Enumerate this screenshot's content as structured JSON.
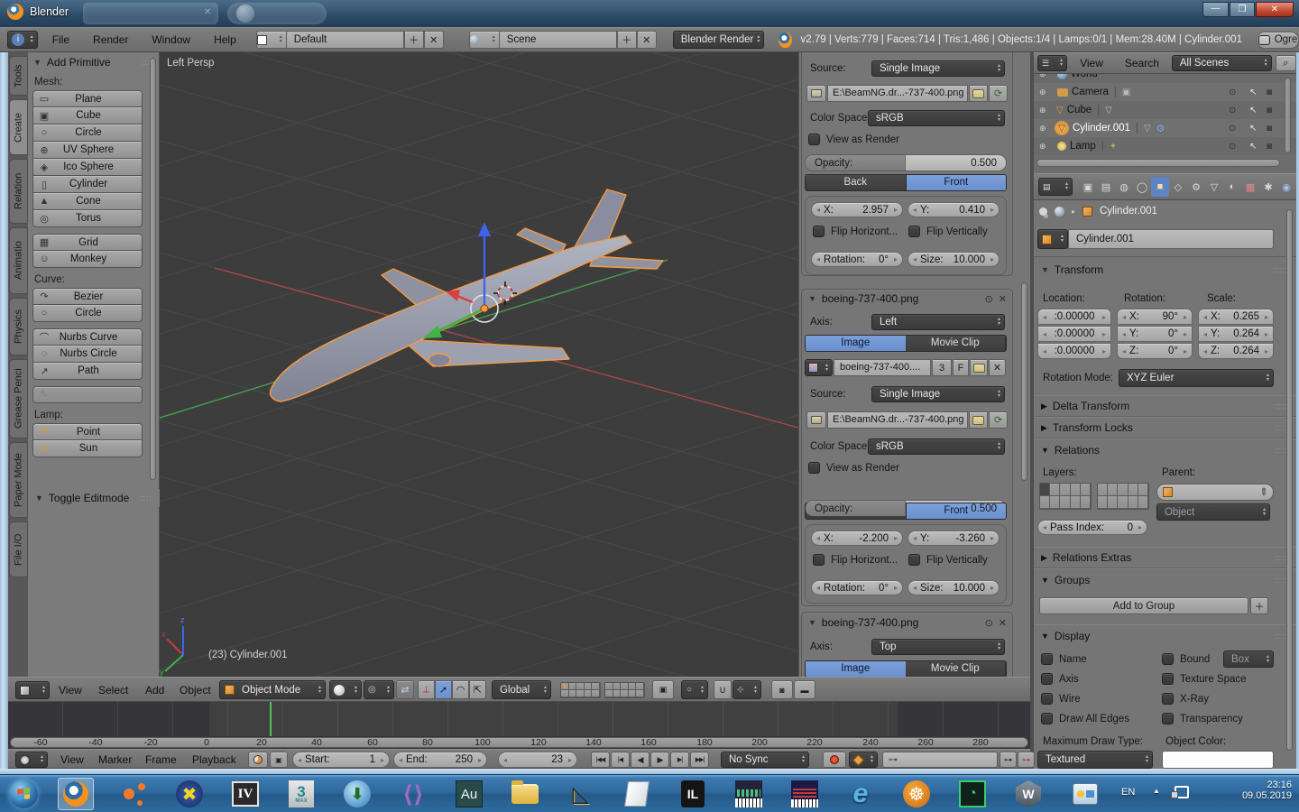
{
  "colors": {
    "accent_blue": "#6a90cf",
    "blender_orange": "#f5921e",
    "selection_outline_orange": "#f49b42",
    "current_frame_green": "#54c554",
    "viewport_bg": "#3d3d3d",
    "taskbar_blue": "#2f6a9e"
  },
  "window": {
    "title": "Blender"
  },
  "header": {
    "menus": [
      "File",
      "Render",
      "Window",
      "Help"
    ],
    "layout": "Default",
    "scene": "Scene",
    "engine": "Blender Render",
    "stats": "v2.79 | Verts:779 | Faces:714 | Tris:1,486 | Objects:1/4 | Lamps:0/1 | Mem:28.40M | Cylinder.001",
    "ogre": "Ogre"
  },
  "toolshelf": {
    "tabs": [
      "Tools",
      "Create",
      "Relation",
      "Animatio",
      "Physics",
      "Grease Penci",
      "Paper Mode",
      "File I/O"
    ],
    "panel_title": "Add Primitive",
    "mesh_label": "Mesh:",
    "mesh": [
      "Plane",
      "Cube",
      "Circle",
      "UV Sphere",
      "Ico Sphere",
      "Cylinder",
      "Cone",
      "Torus"
    ],
    "mesh2": [
      "Grid",
      "Monkey"
    ],
    "curve_label": "Curve:",
    "curve": [
      "Bezier",
      "Circle"
    ],
    "curve2": [
      "Nurbs Curve",
      "Nurbs Circle",
      "Path"
    ],
    "curve_disabled": "Draw Curve",
    "lamp_label": "Lamp:",
    "lamp": [
      "Point",
      "Sun"
    ],
    "editmode_panel": "Toggle Editmode"
  },
  "viewport": {
    "view_label": "Left Persp",
    "status": "(23) Cylinder.001",
    "axis": {
      "x": "x",
      "y": "y",
      "z": "z"
    },
    "header": {
      "menus": [
        "View",
        "Select",
        "Add",
        "Object"
      ],
      "mode": "Object Mode",
      "orientation": "Global"
    }
  },
  "bg_panels": {
    "labels": {
      "source": "Source:",
      "color_space": "Color Space:",
      "view_as_render": "View as Render",
      "opacity": "Opacity:",
      "back": "Back",
      "front": "Front",
      "x": "X:",
      "y": "Y:",
      "flip_h": "Flip Horizont...",
      "flip_v": "Flip Vertically",
      "rotation": "Rotation:",
      "size": "Size:",
      "axis": "Axis:",
      "image": "Image",
      "movie_clip": "Movie Clip"
    },
    "p1": {
      "source": "Single Image",
      "path": "E:\\BeamNG.dr...-737-400.png",
      "color_space": "sRGB",
      "opacity": "0.500",
      "x": "2.957",
      "y": "0.410",
      "rotation": "0°",
      "size": "10.000"
    },
    "p2": {
      "title": "boeing-737-400.png",
      "axis": "Left",
      "datablock": "boeing-737-400....",
      "users": "3",
      "fake": "F",
      "source": "Single Image",
      "path": "E:\\BeamNG.dr...-737-400.png",
      "color_space": "sRGB",
      "opacity": "0.500",
      "x": "-2.200",
      "y": "-3.260",
      "rotation": "0°",
      "size": "10.000"
    },
    "p3": {
      "title": "boeing-737-400.png",
      "axis": "Top"
    }
  },
  "outliner": {
    "menus": [
      "View",
      "Search"
    ],
    "filter": "All Scenes",
    "rows": [
      {
        "name": "World"
      },
      {
        "name": "Camera"
      },
      {
        "name": "Cube"
      },
      {
        "name": "Cylinder.001"
      },
      {
        "name": "Lamp"
      }
    ]
  },
  "properties": {
    "breadcrumb": "Cylinder.001",
    "name": "Cylinder.001",
    "transform": {
      "title": "Transform",
      "location_label": "Location:",
      "rotation_label": "Rotation:",
      "scale_label": "Scale:",
      "location": [
        ":0.00000",
        ":0.00000",
        ":0.00000"
      ],
      "rotation": [
        {
          "l": "X:",
          "v": "90°"
        },
        {
          "l": "Y:",
          "v": "0°"
        },
        {
          "l": "Z:",
          "v": "0°"
        }
      ],
      "scale": [
        {
          "l": "X:",
          "v": "0.265"
        },
        {
          "l": "Y:",
          "v": "0.264"
        },
        {
          "l": "Z:",
          "v": "0.264"
        }
      ],
      "rotation_mode_label": "Rotation Mode:",
      "rotation_mode": "XYZ Euler"
    },
    "sections": {
      "delta": "Delta Transform",
      "locks": "Transform Locks",
      "relations": "Relations",
      "relations_extras": "Relations Extras",
      "groups": "Groups",
      "display": "Display"
    },
    "relations": {
      "layers_label": "Layers:",
      "parent_label": "Parent:",
      "parent_type": "Object",
      "pass_index_label": "Pass Index:",
      "pass_index": "0"
    },
    "groups": {
      "add": "Add to Group"
    },
    "display": {
      "left": [
        "Name",
        "Axis",
        "Wire",
        "Draw All Edges"
      ],
      "right": [
        "Bound",
        "Texture Space",
        "X-Ray",
        "Transparency"
      ],
      "bound_type": "Box",
      "max_draw_label": "Maximum Draw Type:",
      "max_draw": "Textured",
      "object_color_label": "Object Color:"
    }
  },
  "timeline": {
    "menus": [
      "View",
      "Marker",
      "Frame",
      "Playback"
    ],
    "start_label": "Start:",
    "start": "1",
    "end_label": "End:",
    "end": "250",
    "frame": "23",
    "sync": "No Sync",
    "ticks": [
      "-60",
      "-40",
      "-20",
      "0",
      "20",
      "40",
      "60",
      "80",
      "100",
      "120",
      "140",
      "160",
      "180",
      "200",
      "220",
      "240",
      "260",
      "280"
    ]
  },
  "taskbar": {
    "labels": {
      "iv": "IV",
      "max": "3",
      "max_sub": "MAX",
      "au": "Au",
      "il": "IL",
      "ie": "e",
      "w": "W"
    },
    "tray": {
      "lang": "EN",
      "time": "23:16",
      "date": "09.05.2019"
    }
  }
}
